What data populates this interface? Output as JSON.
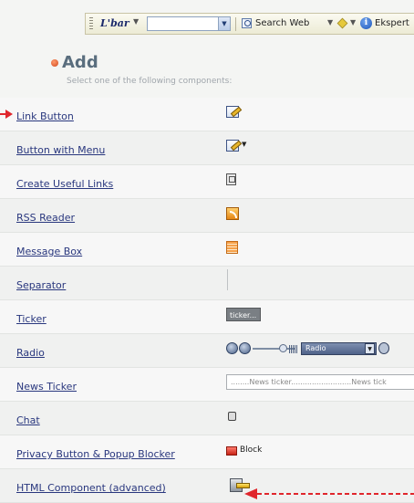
{
  "toolbar": {
    "logo": "L'bar",
    "search_label": "Search Web",
    "expert_label": "Ekspert"
  },
  "header": {
    "title": "Add",
    "subtitle": "Select one of the following components:"
  },
  "components": [
    {
      "label": "Link Button",
      "icon": "pencil-edit-icon"
    },
    {
      "label": "Button with Menu",
      "icon": "pencil-edit-menu-icon"
    },
    {
      "label": "Create Useful Links",
      "icon": "links-page-icon"
    },
    {
      "label": "RSS Reader",
      "icon": "rss-icon"
    },
    {
      "label": "Message Box",
      "icon": "message-box-icon"
    },
    {
      "label": "Separator",
      "icon": "separator-line"
    },
    {
      "label": "Ticker",
      "icon": "ticker-preview",
      "preview_text": "ticker..."
    },
    {
      "label": "Radio",
      "icon": "radio-player-preview",
      "preview_text": "Radio"
    },
    {
      "label": "News Ticker",
      "icon": "news-ticker-preview",
      "preview_text": "........News ticker..........................News tick"
    },
    {
      "label": "Chat",
      "icon": "chat-icon"
    },
    {
      "label": "Privacy Button & Popup Blocker",
      "icon": "block-icon",
      "preview_text": "Block"
    },
    {
      "label": "HTML Component (advanced)",
      "icon": "html-component-icon"
    }
  ],
  "colors": {
    "link": "#29377e",
    "title": "#5a6e7e",
    "annotation_arrow": "#e0262c"
  }
}
